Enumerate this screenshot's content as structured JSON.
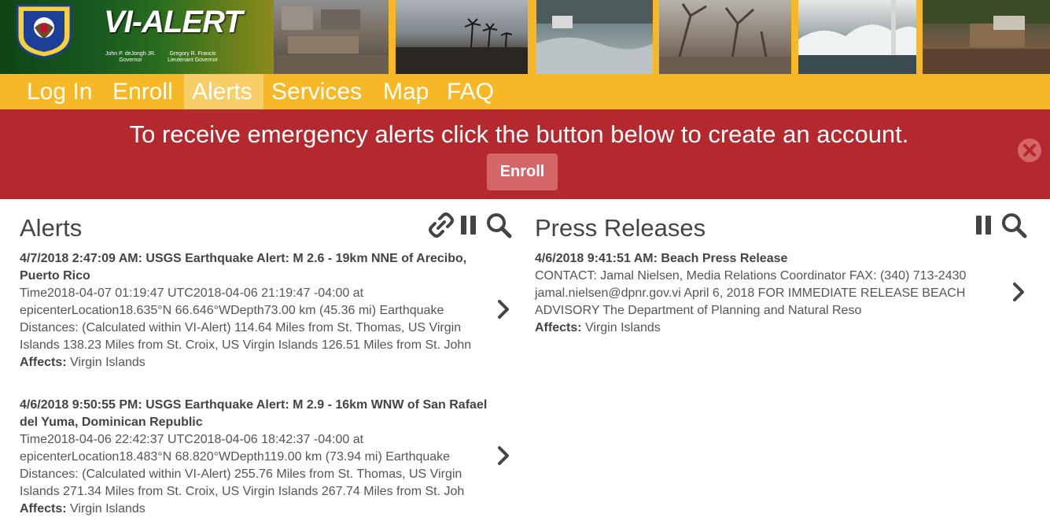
{
  "header": {
    "seal_text": "VIRGIN ISLANDS TERRITORIAL EMERGENCY MANAGEMENT AGENCY",
    "logo_text": "VI-ALERT",
    "governor_name": "John P. deJongh JR.",
    "governor_title": "Governor",
    "lt_governor_name": "Gregory R. Francis",
    "lt_governor_title": "Lieutenant Governor",
    "brand_color": "#f6b827"
  },
  "nav": {
    "items": [
      {
        "label": "Log In"
      },
      {
        "label": "Enroll"
      },
      {
        "label": "Alerts",
        "active": true
      },
      {
        "label": "Services"
      },
      {
        "label": "Map"
      },
      {
        "label": "FAQ"
      }
    ]
  },
  "banner": {
    "message": "To receive emergency alerts click the button below to create an account.",
    "button_label": "Enroll",
    "background": "#b3292d"
  },
  "alerts": {
    "title": "Alerts",
    "icons": [
      "link-icon",
      "pause-icon",
      "search-icon"
    ],
    "items": [
      {
        "heading": "4/7/2018 2:47:09 AM: USGS Earthquake Alert: M 2.6 - 19km NNE of Arecibo, Puerto Rico",
        "body": "Time2018-04-07 01:19:47 UTC2018-04-06 21:19:47 -04:00 at epicenterLocation18.635°N 66.646°WDepth73.00 km (45.36 mi) Earthquake Distances: (Calculated within VI-Alert) 114.64 Miles from St. Thomas, US Virgin Islands 138.23 Miles from St. Croix, US Virgin Islands 126.51 Miles from St. John",
        "affects_label": "Affects:",
        "affects_value": "Virgin Islands"
      },
      {
        "heading": "4/6/2018 9:50:55 PM: USGS Earthquake Alert: M 2.9 - 16km WNW of San Rafael del Yuma, Dominican Republic",
        "body": "Time2018-04-06 22:42:37 UTC2018-04-06 18:42:37 -04:00 at epicenterLocation18.483°N 68.820°WDepth119.00 km (73.94 mi) Earthquake Distances: (Calculated within VI-Alert) 255.76 Miles from St. Thomas, US Virgin Islands 271.34 Miles from St. Croix, US Virgin Islands 267.74 Miles from St. Joh",
        "affects_label": "Affects:",
        "affects_value": "Virgin Islands"
      }
    ]
  },
  "press": {
    "title": "Press Releases",
    "icons": [
      "pause-icon",
      "search-icon"
    ],
    "items": [
      {
        "heading": "4/6/2018 9:41:51 AM: Beach Press Release",
        "body": "CONTACT: Jamal Nielsen, Media Relations Coordinator   FAX: (340) 713-2430 jamal.nielsen@dpnr.gov.vi   April 6, 2018   FOR IMMEDIATE RELEASE   BEACH ADVISORY   The Department of Planning and Natural Reso",
        "affects_label": "Affects:",
        "affects_value": "Virgin Islands"
      }
    ]
  }
}
